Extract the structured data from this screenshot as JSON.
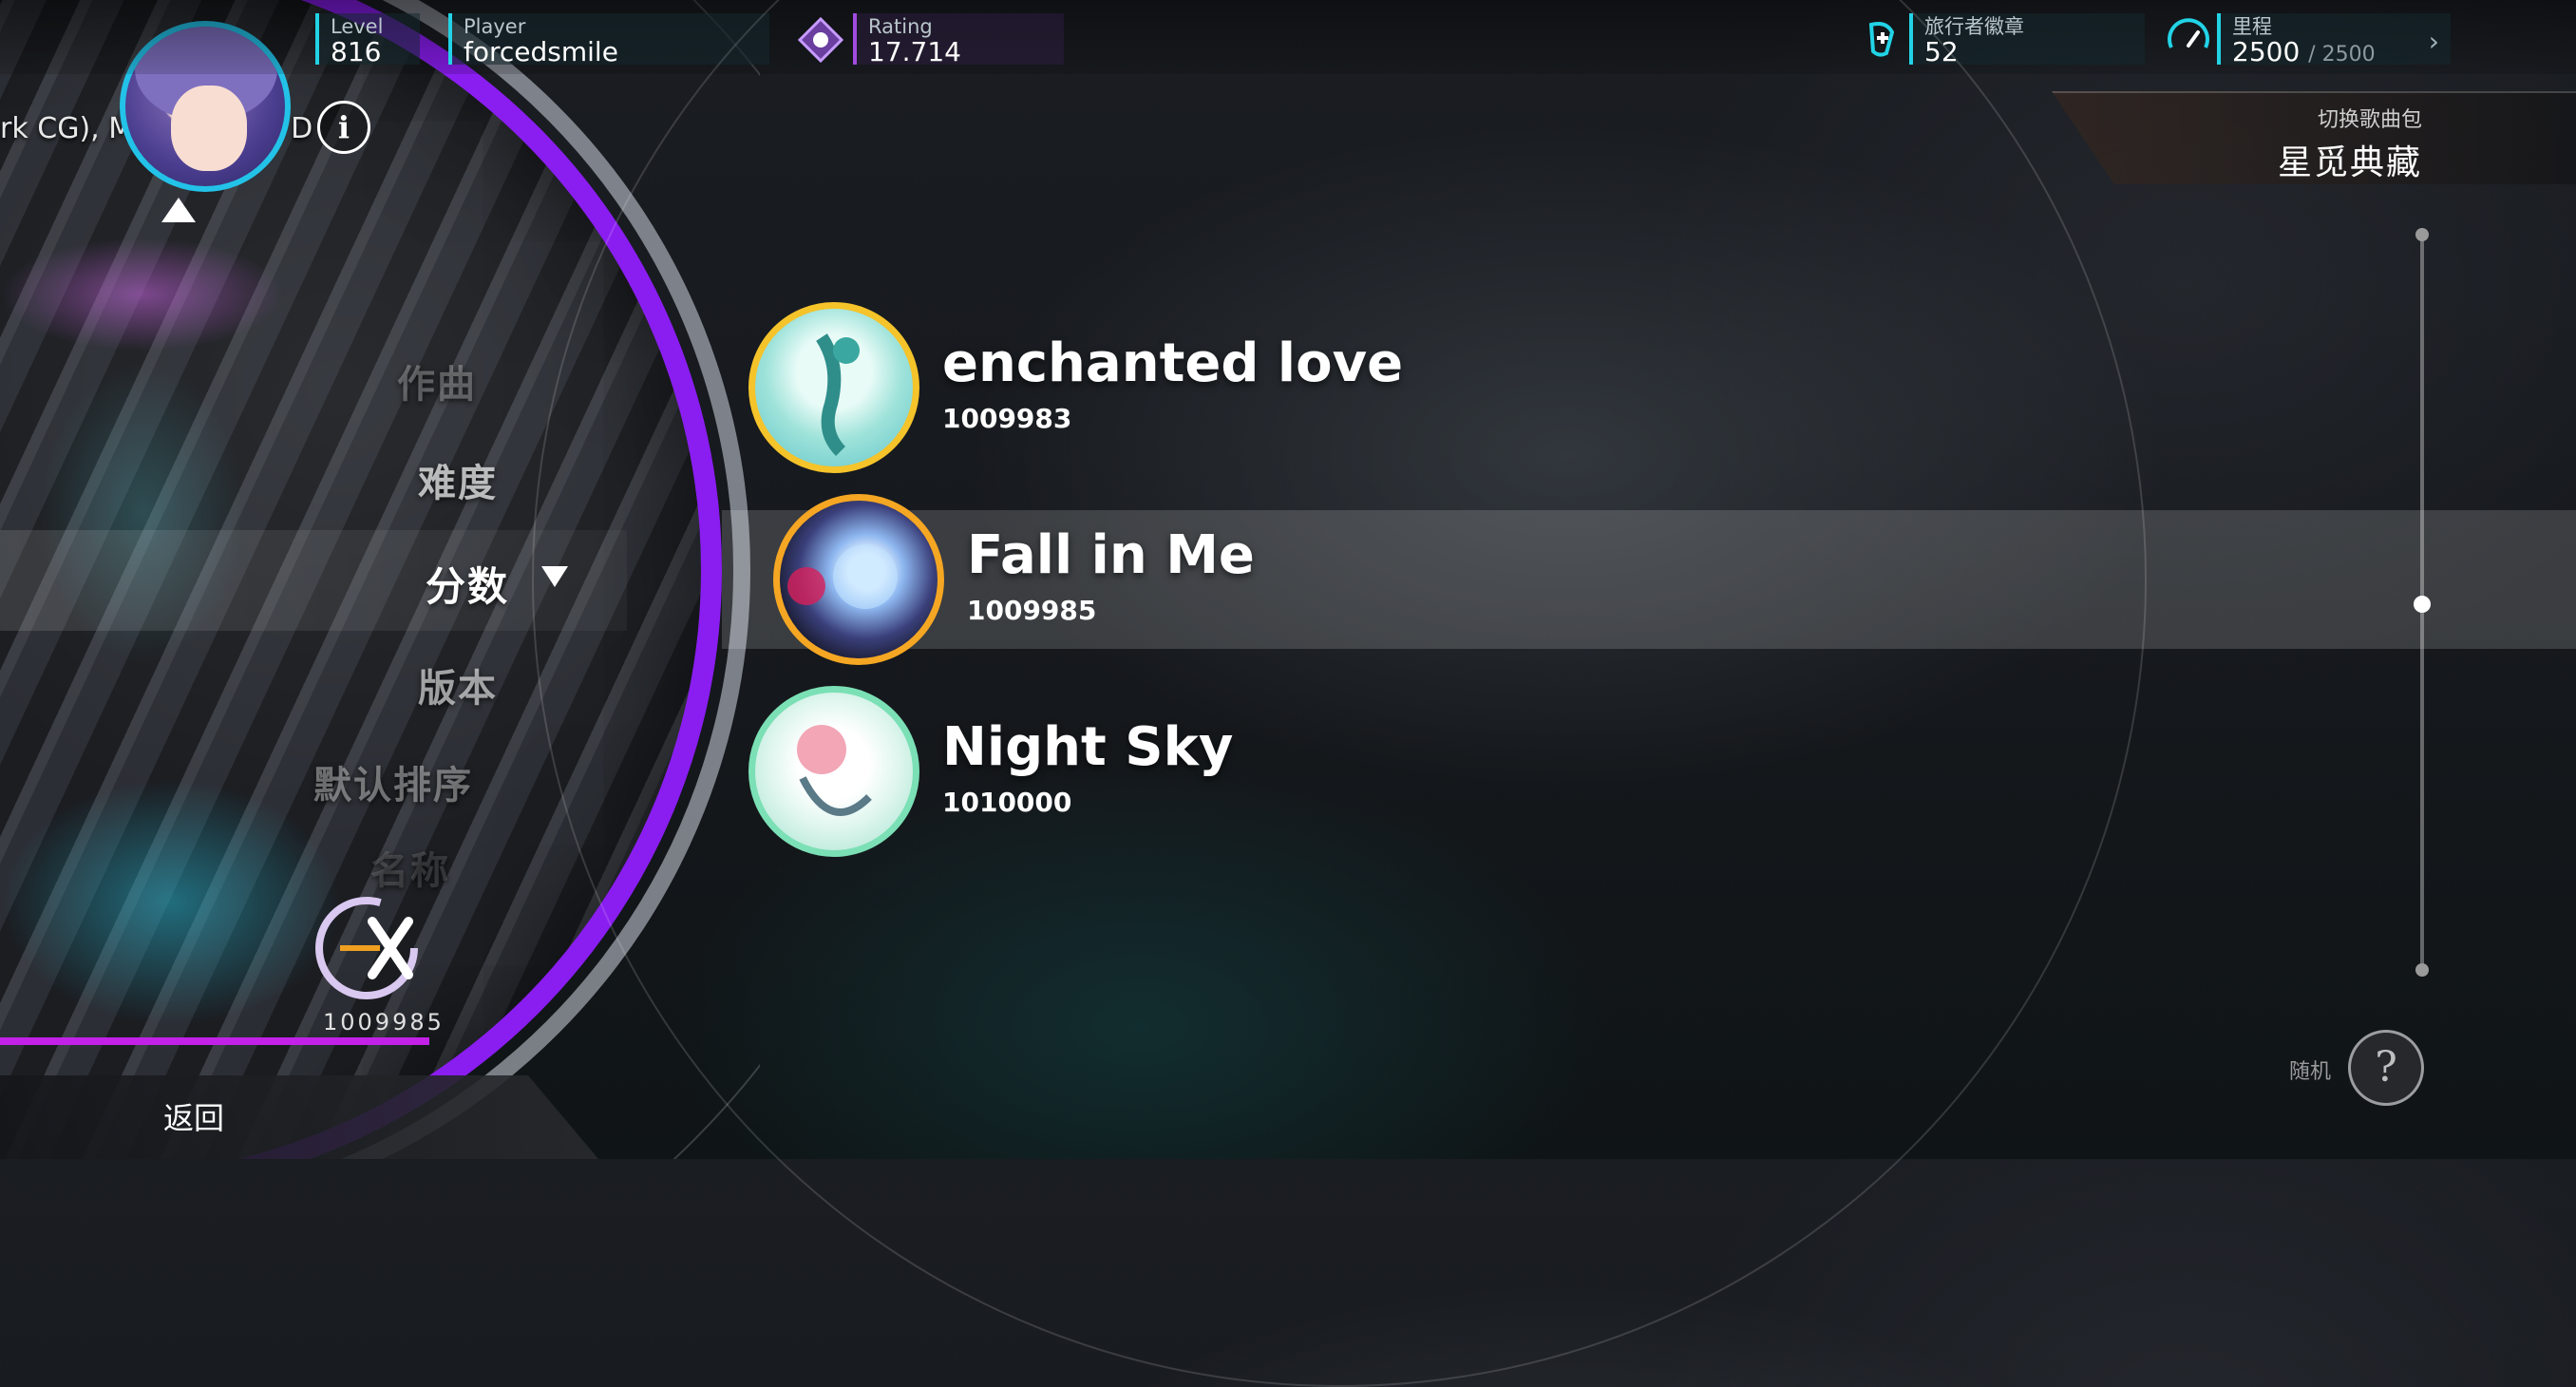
{
  "header": {
    "level": {
      "label": "Level",
      "value": "816"
    },
    "player": {
      "label": "Player",
      "value": "forcedsmile"
    },
    "rating": {
      "label": "Rating",
      "value": "17.714"
    },
    "badges": {
      "label": "旅行者徽章",
      "value": "52"
    },
    "mileage": {
      "label": "里程",
      "value": "2500",
      "max": "/ 2500"
    }
  },
  "song_credit": "rk CG), M",
  "song_credit_tail": "D",
  "sort_menu": {
    "items": [
      "作曲",
      "难度",
      "分数",
      "版本",
      "默认排序"
    ],
    "active": "分数",
    "partial_bottom": "名称"
  },
  "current": {
    "score": "1009985"
  },
  "back_label": "返回",
  "songs": [
    {
      "title": "enchanted love",
      "score": "1009983"
    },
    {
      "title": "Fall in Me",
      "score": "1009985"
    },
    {
      "title": "Night Sky",
      "score": "1010000"
    }
  ],
  "pack": {
    "label": "切换歌曲包",
    "name": "星觅典藏"
  },
  "random_label": "随机",
  "random_icon": "?",
  "colors": {
    "accent_cyan": "#22d3e6",
    "disc_purple": "#8a1df0",
    "progress_magenta": "#c321e8"
  }
}
